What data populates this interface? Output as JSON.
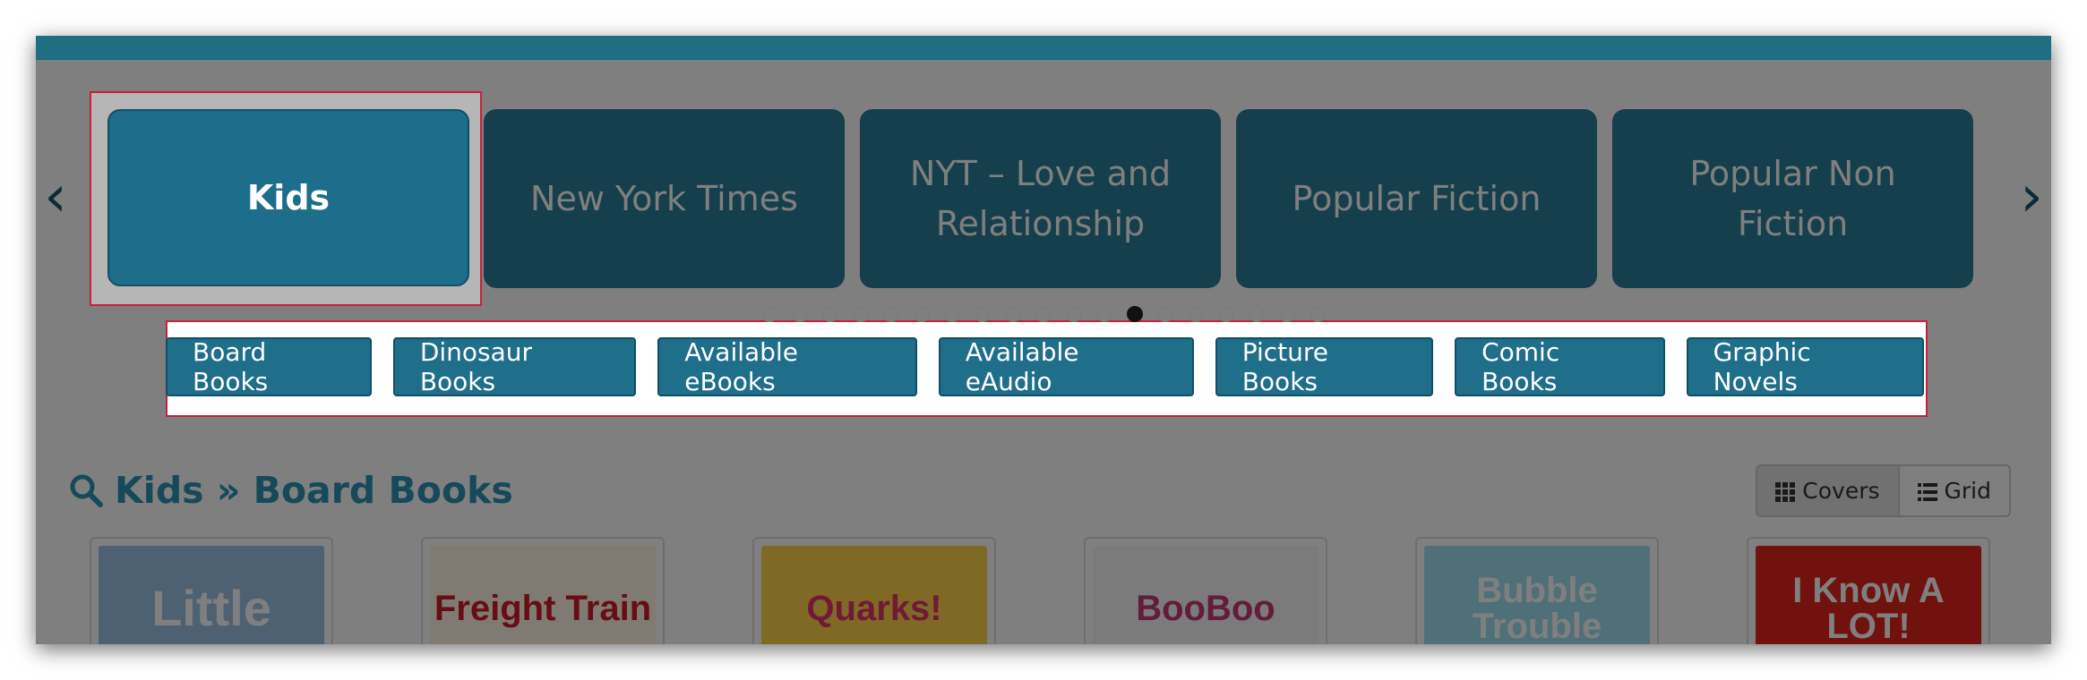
{
  "carousel": {
    "prev_icon": "chevron-left-icon",
    "next_icon": "chevron-right-icon",
    "prev_glyph": "‹",
    "next_glyph": "›",
    "tiles": [
      {
        "label": "Kids",
        "active": true
      },
      {
        "label": "New York Times",
        "active": false
      },
      {
        "label": "NYT – Love and Relationship",
        "active": false
      },
      {
        "label": "Popular Fiction",
        "active": false
      },
      {
        "label": "Popular Non Fiction",
        "active": false
      }
    ],
    "dots_total": 19,
    "dots_active_index": 12
  },
  "subcategories": [
    "Board Books",
    "Dinosaur Books",
    "Available eBooks",
    "Available eAudio",
    "Picture Books",
    "Comic Books",
    "Graphic Novels"
  ],
  "results": {
    "heading": "Kids » Board Books",
    "search_icon": "search-icon",
    "view_options": [
      {
        "label": "Covers",
        "icon": "grid-icon",
        "selected": true
      },
      {
        "label": "Grid",
        "icon": "list-icon",
        "selected": false
      }
    ]
  },
  "covers": [
    {
      "title": "Little",
      "colors": [
        "#9cc3e6",
        "#ffffff"
      ]
    },
    {
      "title": "Freight Train",
      "colors": [
        "#fff6e6",
        "#d31b2a"
      ]
    },
    {
      "title": "Quarks!",
      "colors": [
        "#ffd24a",
        "#e0356f"
      ]
    },
    {
      "title": "BooBoo",
      "colors": [
        "#f7f7f7",
        "#c23a73"
      ]
    },
    {
      "title": "Bubble Trouble",
      "colors": [
        "#9fe0f0",
        "#ffffff"
      ]
    },
    {
      "title": "I Know A LOT!",
      "colors": [
        "#e2241c",
        "#ffffff"
      ]
    }
  ],
  "theme": {
    "accent": "#1f6e8a",
    "focus": "#c8203a"
  }
}
